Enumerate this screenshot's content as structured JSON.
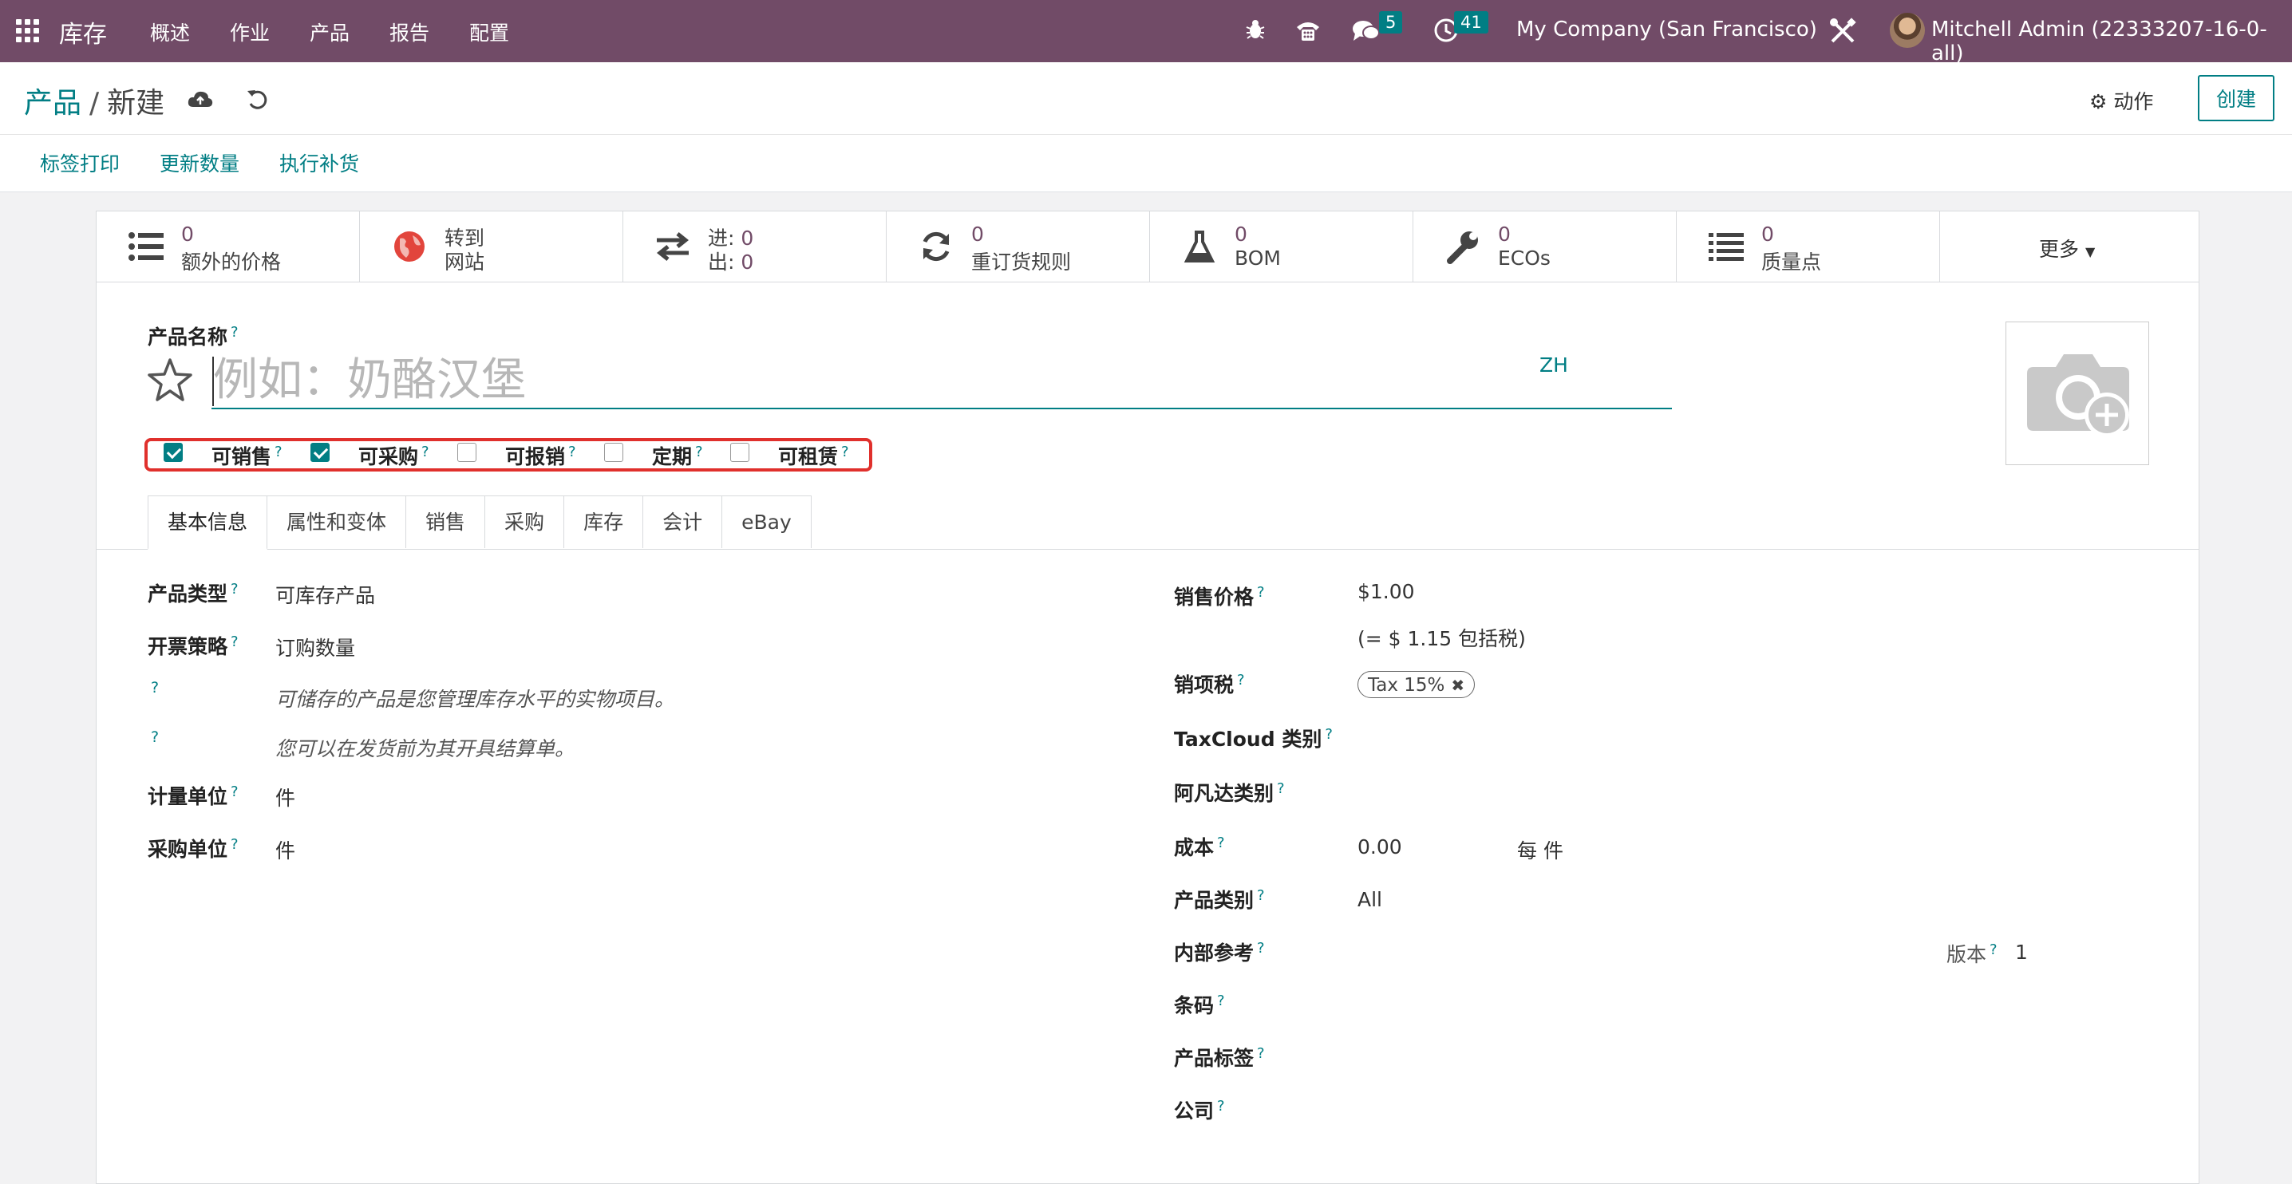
{
  "navbar": {
    "brand": "库存",
    "menus": [
      "概述",
      "作业",
      "产品",
      "报告",
      "配置"
    ],
    "chat_count": "5",
    "activity_count": "41",
    "company": "My Company (San Francisco)",
    "user": "Mitchell Admin (22333207-16-0-all)",
    "bg_color": "#714b67"
  },
  "breadcrumb": {
    "parent": "产品",
    "separator": "/",
    "current": "新建"
  },
  "control": {
    "action_label": "动作",
    "create_label": "创建"
  },
  "header_buttons": [
    "标签打印",
    "更新数量",
    "执行补货"
  ],
  "smart_buttons": [
    {
      "value": "0",
      "label": "额外的价格",
      "icon": "list-icon"
    },
    {
      "line1": "转到",
      "line2": "网站",
      "icon": "globe-icon"
    },
    {
      "in_label": "进:",
      "in_value": "0",
      "out_label": "出:",
      "out_value": "0",
      "icon": "exchange-icon"
    },
    {
      "value": "0",
      "label": "重订货规则",
      "icon": "refresh-icon"
    },
    {
      "value": "0",
      "label": "BOM",
      "icon": "flask-icon"
    },
    {
      "value": "0",
      "label": "ECOs",
      "icon": "wrench-icon"
    },
    {
      "value": "0",
      "label": "质量点",
      "icon": "list-icon"
    },
    {
      "label": "更多"
    }
  ],
  "product": {
    "name_label": "产品名称",
    "name_placeholder": "例如：奶酪汉堡",
    "lang": "ZH",
    "q": "?"
  },
  "checkboxes": [
    {
      "label": "可销售",
      "checked": true
    },
    {
      "label": "可采购",
      "checked": true
    },
    {
      "label": "可报销",
      "checked": false
    },
    {
      "label": "定期",
      "checked": false
    },
    {
      "label": "可租赁",
      "checked": false
    }
  ],
  "tabs": [
    "基本信息",
    "属性和变体",
    "销售",
    "采购",
    "库存",
    "会计",
    "eBay"
  ],
  "left_fields": {
    "type_label": "产品类型",
    "type_value": "可库存产品",
    "invoice_label": "开票策略",
    "invoice_value": "订购数量",
    "help1": "可储存的产品是您管理库存水平的实物项目。",
    "help2": "您可以在发货前为其开具结算单。",
    "uom_label": "计量单位",
    "uom_value": "件",
    "po_uom_label": "采购单位",
    "po_uom_value": "件"
  },
  "right_fields": {
    "price_label": "销售价格",
    "price_value": "$1.00",
    "price_incl": "(= $ 1.15 包括税)",
    "tax_label": "销项税",
    "tax_tag": "Tax 15%",
    "taxcloud_label": "TaxCloud 类别",
    "avalara_label": "阿凡达类别",
    "cost_label": "成本",
    "cost_value": "0.00",
    "cost_unit": "每 件",
    "categ_label": "产品类别",
    "categ_value": "All",
    "ref_label": "内部参考",
    "version_label": "版本",
    "version_value": "1",
    "barcode_label": "条码",
    "tags_label": "产品标签",
    "company_label": "公司"
  }
}
